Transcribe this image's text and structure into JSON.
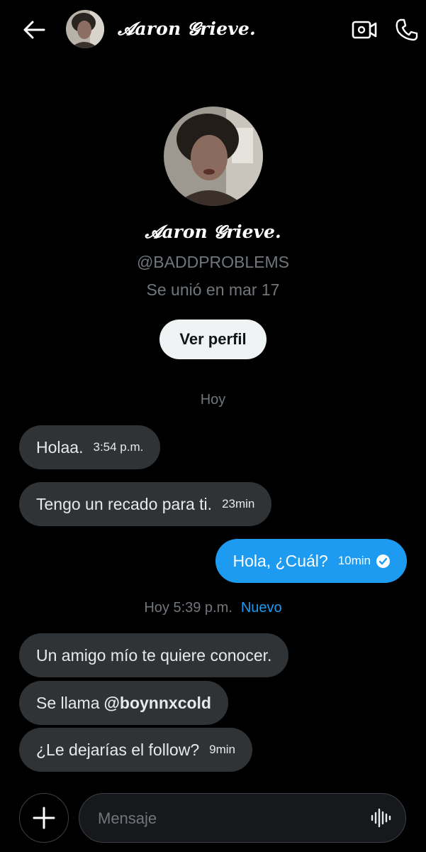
{
  "header": {
    "name": "𝓐aron 𝓖rieve.",
    "back_icon": "arrow-left-icon",
    "video_icon": "video-camera-icon",
    "call_icon": "phone-icon"
  },
  "profile": {
    "name": "𝓐aron 𝓖rieve.",
    "handle": "@BADDPROBLEMS",
    "joined": "Se unió en mar 17",
    "view_profile_label": "Ver perfil"
  },
  "separators": {
    "first": "Hoy",
    "second": "Hoy 5:39 p.m.",
    "second_badge": "Nuevo"
  },
  "messages": [
    {
      "text": "Holaa.",
      "time": "3:54 p.m.",
      "direction": "in"
    },
    {
      "text": "Tengo un recado para ti.",
      "time": "23min",
      "direction": "in"
    },
    {
      "text": "Hola, ¿Cuál?",
      "time": "10min",
      "direction": "out",
      "read": true
    },
    {
      "text": "Un amigo mío te quiere conocer.",
      "time": "",
      "direction": "in"
    },
    {
      "text": "Se llama",
      "mention": "@boynnxcold",
      "time": "",
      "direction": "in"
    },
    {
      "text": "¿Le dejarías el follow?",
      "time": "9min",
      "direction": "in"
    }
  ],
  "composer": {
    "placeholder": "Mensaje",
    "plus_icon": "plus-icon",
    "mic_icon": "voice-waveform-icon"
  },
  "colors": {
    "background": "#000000",
    "incoming_bubble": "#2f3336",
    "outgoing_bubble": "#1d9bf0",
    "muted_text": "#71767b",
    "accent": "#1d9bf0"
  }
}
